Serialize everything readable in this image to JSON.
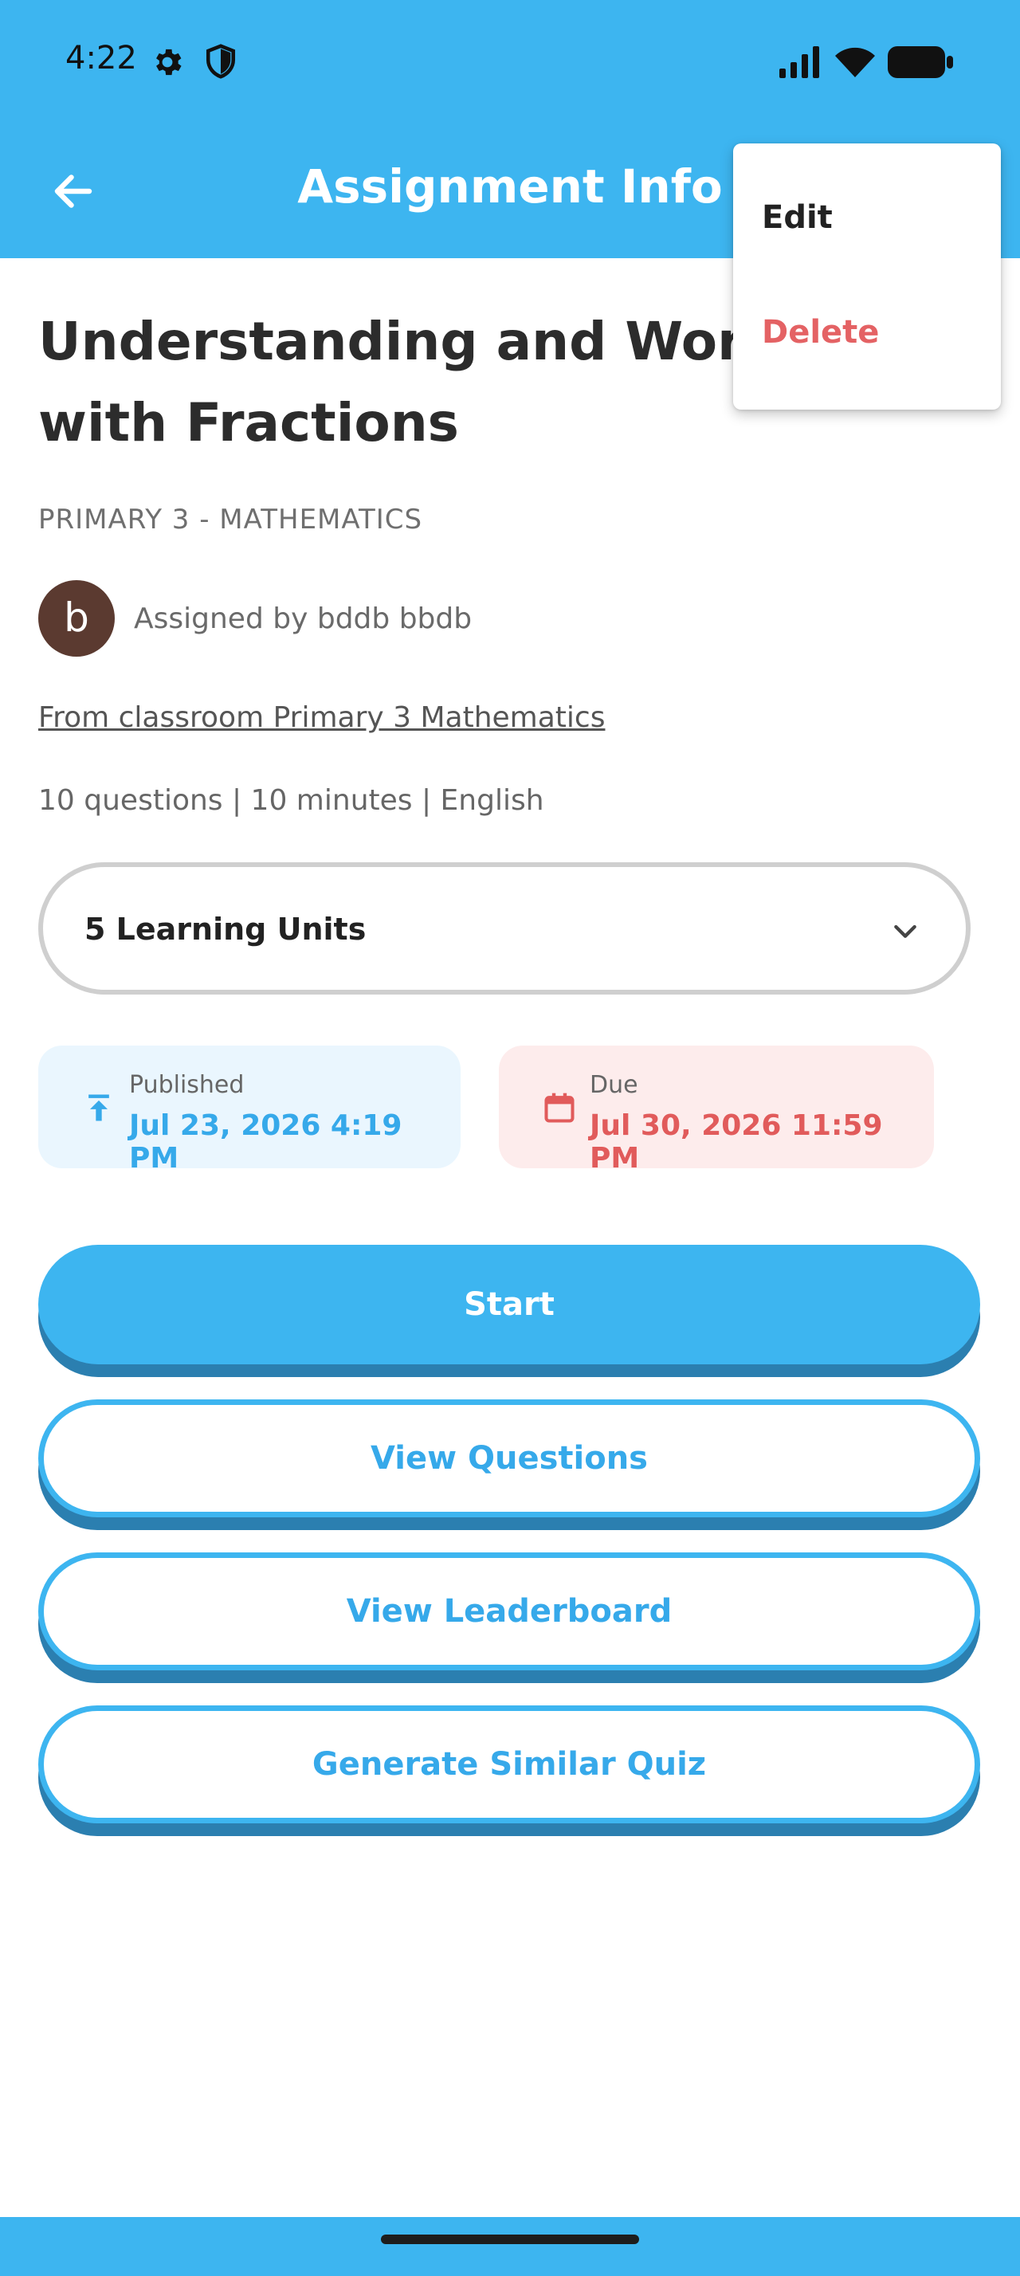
{
  "status_bar": {
    "time": "4:22"
  },
  "app_bar": {
    "title": "Assignment Info"
  },
  "menu": {
    "edit_label": "Edit",
    "delete_label": "Delete"
  },
  "assignment": {
    "title": "Understanding and Working with Fractions",
    "subject": "PRIMARY 3 - MATHEMATICS",
    "avatar_letter": "b",
    "assigned_by": "Assigned by bddb bbdb",
    "classroom_link": "From classroom Primary 3 Mathematics",
    "meta": "10 questions | 10 minutes | English",
    "learning_units": "5 Learning Units"
  },
  "published": {
    "label": "Published",
    "value": "Jul 23, 2026 4:19 PM"
  },
  "due": {
    "label": "Due",
    "value": "Jul 30, 2026 11:59 PM"
  },
  "buttons": {
    "start": "Start",
    "view_questions": "View Questions",
    "view_leaderboard": "View Leaderboard",
    "generate_similar": "Generate Similar Quiz"
  },
  "colors": {
    "primary": "#3db5f0",
    "primary_shadow": "#2b7fb0",
    "danger": "#e15b5b",
    "published_bg": "#eaf6fe",
    "due_bg": "#fdecec"
  }
}
